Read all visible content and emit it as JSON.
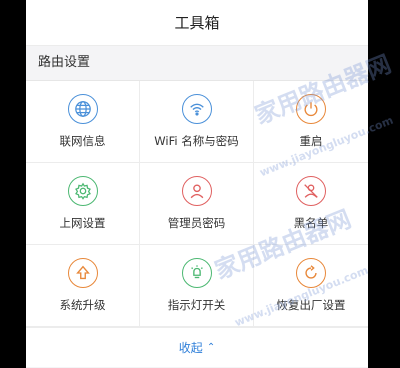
{
  "header": {
    "title": "工具箱"
  },
  "section": {
    "title": "路由设置"
  },
  "tools": [
    {
      "label": "联网信息",
      "icon": "globe-icon",
      "color": "#4a90d9"
    },
    {
      "label": "WiFi 名称与密码",
      "icon": "wifi-icon",
      "color": "#4a90d9"
    },
    {
      "label": "重启",
      "icon": "power-icon",
      "color": "#e8883a"
    },
    {
      "label": "上网设置",
      "icon": "gear-icon",
      "color": "#4cb872"
    },
    {
      "label": "管理员密码",
      "icon": "user-icon",
      "color": "#e06060"
    },
    {
      "label": "黑名单",
      "icon": "block-icon",
      "color": "#e06060"
    },
    {
      "label": "系统升级",
      "icon": "upgrade-icon",
      "color": "#e8883a"
    },
    {
      "label": "指示灯开关",
      "icon": "bulb-icon",
      "color": "#4cb872"
    },
    {
      "label": "恢复出厂设置",
      "icon": "restore-icon",
      "color": "#e8883a"
    }
  ],
  "footer": {
    "collapse_label": "收起"
  },
  "watermark": {
    "brand": "家用路由器网",
    "url": "www.jiayongluyou.com"
  }
}
